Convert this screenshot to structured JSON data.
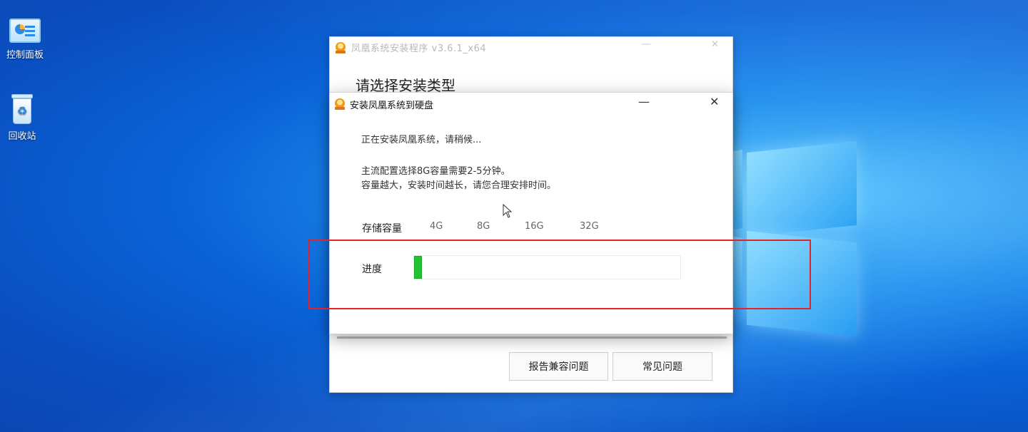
{
  "desktop": {
    "icons": [
      {
        "label": "控制面板",
        "icon": "control-panel-icon"
      },
      {
        "label": "回收站",
        "icon": "recycle-bin-icon"
      }
    ]
  },
  "installer_window": {
    "title": "凤凰系统安装程序 v3.6.1_x64",
    "heading": "请选择安装类型",
    "buttons": {
      "report": "报告兼容问题",
      "faq": "常见问题"
    }
  },
  "install_dialog": {
    "title": "安装凤凰系统到硬盘",
    "status": "正在安装凤凰系统，请稍候...",
    "tip_line1": "主流配置选择8G容量需要2-5分钟。",
    "tip_line2": "容量越大，安装时间越长，请您合理安排时间。",
    "capacity_label": "存储容量",
    "capacity_options": [
      "4G",
      "8G",
      "16G",
      "32G"
    ],
    "progress_label": "进度",
    "progress": 0.03
  },
  "colors": {
    "progress_fill": "#22c232",
    "highlight_border": "#e0242a"
  }
}
